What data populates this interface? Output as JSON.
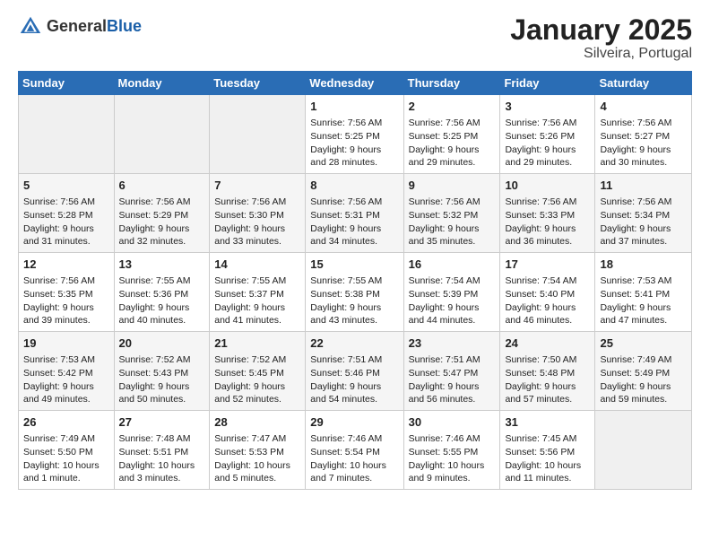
{
  "header": {
    "logo_general": "General",
    "logo_blue": "Blue",
    "title": "January 2025",
    "subtitle": "Silveira, Portugal"
  },
  "days_of_week": [
    "Sunday",
    "Monday",
    "Tuesday",
    "Wednesday",
    "Thursday",
    "Friday",
    "Saturday"
  ],
  "weeks": [
    [
      {
        "day": "",
        "empty": true
      },
      {
        "day": "",
        "empty": true
      },
      {
        "day": "",
        "empty": true
      },
      {
        "day": "1",
        "sunrise": "Sunrise: 7:56 AM",
        "sunset": "Sunset: 5:25 PM",
        "daylight": "Daylight: 9 hours and 28 minutes."
      },
      {
        "day": "2",
        "sunrise": "Sunrise: 7:56 AM",
        "sunset": "Sunset: 5:25 PM",
        "daylight": "Daylight: 9 hours and 29 minutes."
      },
      {
        "day": "3",
        "sunrise": "Sunrise: 7:56 AM",
        "sunset": "Sunset: 5:26 PM",
        "daylight": "Daylight: 9 hours and 29 minutes."
      },
      {
        "day": "4",
        "sunrise": "Sunrise: 7:56 AM",
        "sunset": "Sunset: 5:27 PM",
        "daylight": "Daylight: 9 hours and 30 minutes."
      }
    ],
    [
      {
        "day": "5",
        "sunrise": "Sunrise: 7:56 AM",
        "sunset": "Sunset: 5:28 PM",
        "daylight": "Daylight: 9 hours and 31 minutes."
      },
      {
        "day": "6",
        "sunrise": "Sunrise: 7:56 AM",
        "sunset": "Sunset: 5:29 PM",
        "daylight": "Daylight: 9 hours and 32 minutes."
      },
      {
        "day": "7",
        "sunrise": "Sunrise: 7:56 AM",
        "sunset": "Sunset: 5:30 PM",
        "daylight": "Daylight: 9 hours and 33 minutes."
      },
      {
        "day": "8",
        "sunrise": "Sunrise: 7:56 AM",
        "sunset": "Sunset: 5:31 PM",
        "daylight": "Daylight: 9 hours and 34 minutes."
      },
      {
        "day": "9",
        "sunrise": "Sunrise: 7:56 AM",
        "sunset": "Sunset: 5:32 PM",
        "daylight": "Daylight: 9 hours and 35 minutes."
      },
      {
        "day": "10",
        "sunrise": "Sunrise: 7:56 AM",
        "sunset": "Sunset: 5:33 PM",
        "daylight": "Daylight: 9 hours and 36 minutes."
      },
      {
        "day": "11",
        "sunrise": "Sunrise: 7:56 AM",
        "sunset": "Sunset: 5:34 PM",
        "daylight": "Daylight: 9 hours and 37 minutes."
      }
    ],
    [
      {
        "day": "12",
        "sunrise": "Sunrise: 7:56 AM",
        "sunset": "Sunset: 5:35 PM",
        "daylight": "Daylight: 9 hours and 39 minutes."
      },
      {
        "day": "13",
        "sunrise": "Sunrise: 7:55 AM",
        "sunset": "Sunset: 5:36 PM",
        "daylight": "Daylight: 9 hours and 40 minutes."
      },
      {
        "day": "14",
        "sunrise": "Sunrise: 7:55 AM",
        "sunset": "Sunset: 5:37 PM",
        "daylight": "Daylight: 9 hours and 41 minutes."
      },
      {
        "day": "15",
        "sunrise": "Sunrise: 7:55 AM",
        "sunset": "Sunset: 5:38 PM",
        "daylight": "Daylight: 9 hours and 43 minutes."
      },
      {
        "day": "16",
        "sunrise": "Sunrise: 7:54 AM",
        "sunset": "Sunset: 5:39 PM",
        "daylight": "Daylight: 9 hours and 44 minutes."
      },
      {
        "day": "17",
        "sunrise": "Sunrise: 7:54 AM",
        "sunset": "Sunset: 5:40 PM",
        "daylight": "Daylight: 9 hours and 46 minutes."
      },
      {
        "day": "18",
        "sunrise": "Sunrise: 7:53 AM",
        "sunset": "Sunset: 5:41 PM",
        "daylight": "Daylight: 9 hours and 47 minutes."
      }
    ],
    [
      {
        "day": "19",
        "sunrise": "Sunrise: 7:53 AM",
        "sunset": "Sunset: 5:42 PM",
        "daylight": "Daylight: 9 hours and 49 minutes."
      },
      {
        "day": "20",
        "sunrise": "Sunrise: 7:52 AM",
        "sunset": "Sunset: 5:43 PM",
        "daylight": "Daylight: 9 hours and 50 minutes."
      },
      {
        "day": "21",
        "sunrise": "Sunrise: 7:52 AM",
        "sunset": "Sunset: 5:45 PM",
        "daylight": "Daylight: 9 hours and 52 minutes."
      },
      {
        "day": "22",
        "sunrise": "Sunrise: 7:51 AM",
        "sunset": "Sunset: 5:46 PM",
        "daylight": "Daylight: 9 hours and 54 minutes."
      },
      {
        "day": "23",
        "sunrise": "Sunrise: 7:51 AM",
        "sunset": "Sunset: 5:47 PM",
        "daylight": "Daylight: 9 hours and 56 minutes."
      },
      {
        "day": "24",
        "sunrise": "Sunrise: 7:50 AM",
        "sunset": "Sunset: 5:48 PM",
        "daylight": "Daylight: 9 hours and 57 minutes."
      },
      {
        "day": "25",
        "sunrise": "Sunrise: 7:49 AM",
        "sunset": "Sunset: 5:49 PM",
        "daylight": "Daylight: 9 hours and 59 minutes."
      }
    ],
    [
      {
        "day": "26",
        "sunrise": "Sunrise: 7:49 AM",
        "sunset": "Sunset: 5:50 PM",
        "daylight": "Daylight: 10 hours and 1 minute."
      },
      {
        "day": "27",
        "sunrise": "Sunrise: 7:48 AM",
        "sunset": "Sunset: 5:51 PM",
        "daylight": "Daylight: 10 hours and 3 minutes."
      },
      {
        "day": "28",
        "sunrise": "Sunrise: 7:47 AM",
        "sunset": "Sunset: 5:53 PM",
        "daylight": "Daylight: 10 hours and 5 minutes."
      },
      {
        "day": "29",
        "sunrise": "Sunrise: 7:46 AM",
        "sunset": "Sunset: 5:54 PM",
        "daylight": "Daylight: 10 hours and 7 minutes."
      },
      {
        "day": "30",
        "sunrise": "Sunrise: 7:46 AM",
        "sunset": "Sunset: 5:55 PM",
        "daylight": "Daylight: 10 hours and 9 minutes."
      },
      {
        "day": "31",
        "sunrise": "Sunrise: 7:45 AM",
        "sunset": "Sunset: 5:56 PM",
        "daylight": "Daylight: 10 hours and 11 minutes."
      },
      {
        "day": "",
        "empty": true
      }
    ]
  ]
}
